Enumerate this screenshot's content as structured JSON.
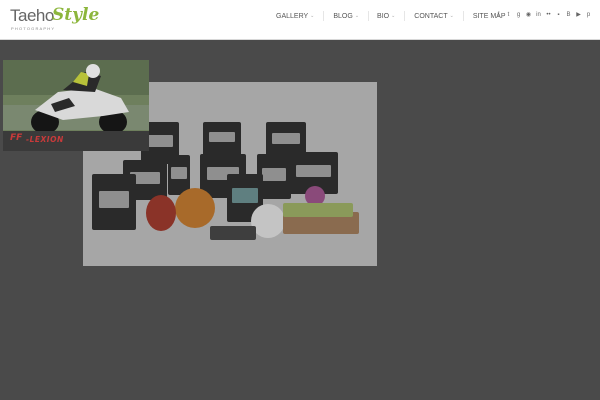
{
  "site": {
    "logo_main": "Taeho",
    "logo_script": "Style",
    "logo_sub": "PHOTOGRAPHY"
  },
  "nav": {
    "items": [
      {
        "label": "GALLERY",
        "has_dropdown": true
      },
      {
        "label": "BLOG",
        "has_dropdown": true
      },
      {
        "label": "BIO",
        "has_dropdown": true
      },
      {
        "label": "CONTACT",
        "has_dropdown": true
      },
      {
        "label": "SITE MAP",
        "has_dropdown": false
      }
    ],
    "caret": "⌄"
  },
  "social": [
    {
      "name": "facebook-icon",
      "glyph": "f"
    },
    {
      "name": "twitter-icon",
      "glyph": "t"
    },
    {
      "name": "google-plus-icon",
      "glyph": "g"
    },
    {
      "name": "rss-icon",
      "glyph": "◉"
    },
    {
      "name": "linkedin-icon",
      "glyph": "in"
    },
    {
      "name": "flickr-icon",
      "glyph": "••"
    },
    {
      "name": "delicious-icon",
      "glyph": "▪"
    },
    {
      "name": "blogger-icon",
      "glyph": "B"
    },
    {
      "name": "youtube-icon",
      "glyph": "▶"
    },
    {
      "name": "pinterest-icon",
      "glyph": "p"
    }
  ],
  "ad": {
    "logo": "FF",
    "brand": "-LEXION"
  },
  "colors": {
    "overlay": "#4a4a4a",
    "accent_logo": "#8cb63c",
    "ad_brand": "#c83a3a"
  }
}
